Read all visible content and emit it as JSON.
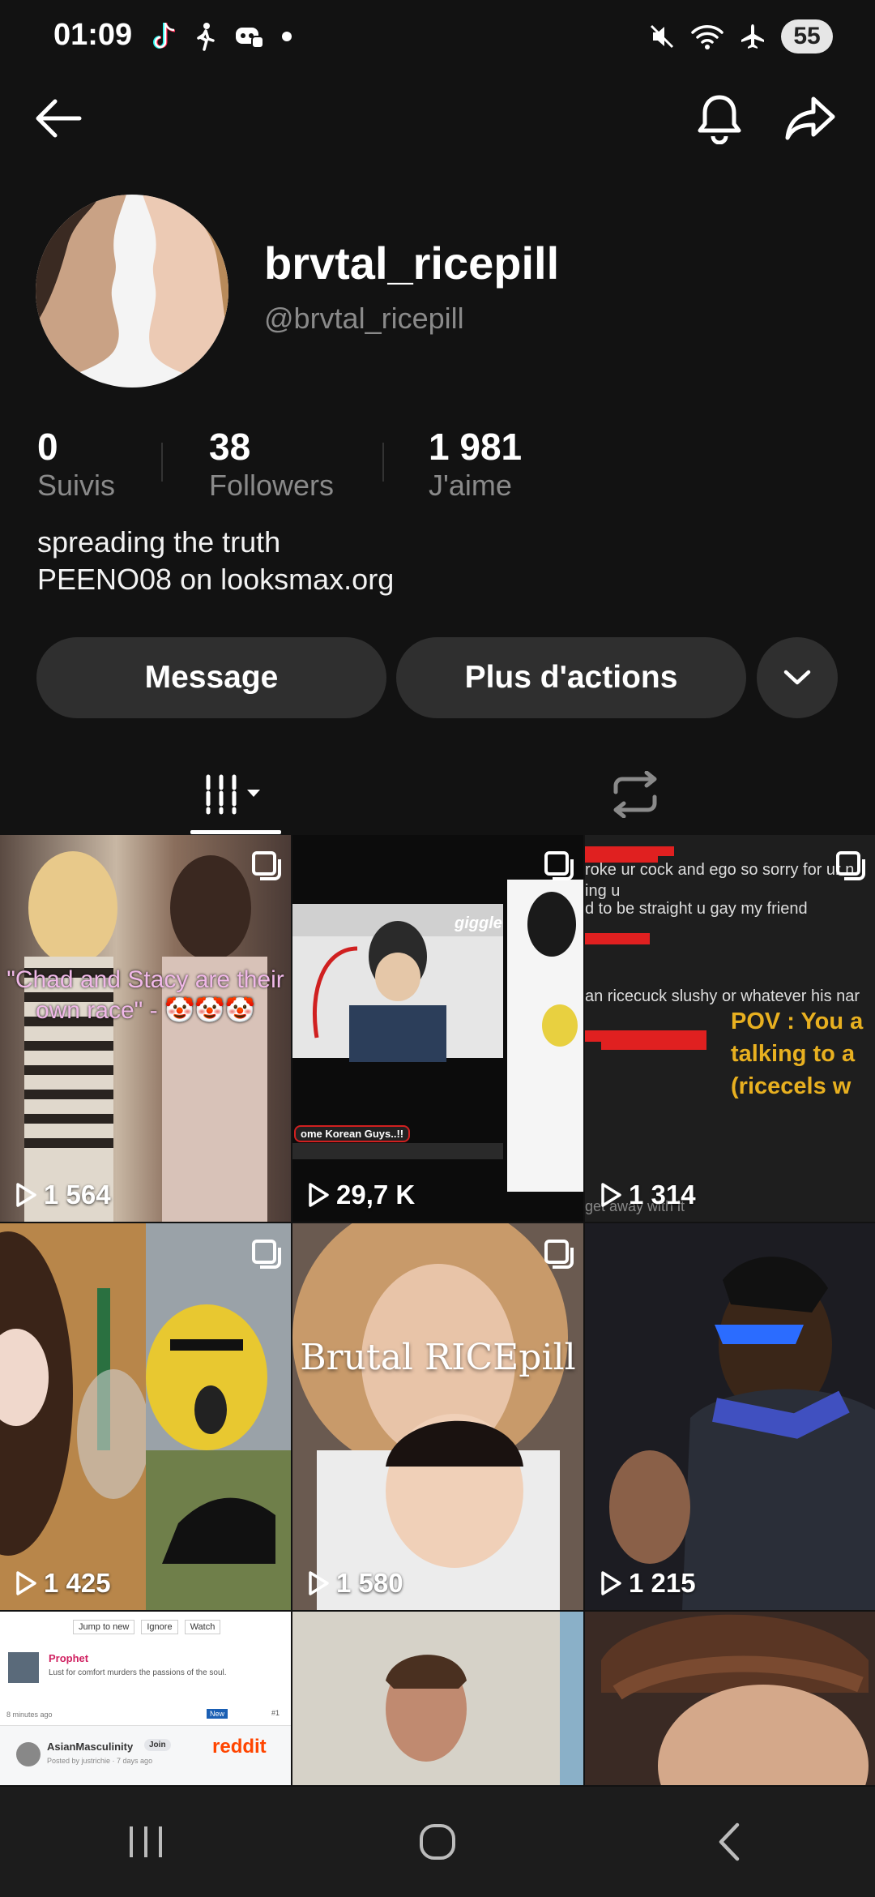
{
  "status_bar": {
    "time": "01:09",
    "battery": "55"
  },
  "profile": {
    "name": "brvtal_ricepill",
    "handle": "@brvtal_ricepill",
    "stats": [
      {
        "value": "0",
        "label": "Suivis"
      },
      {
        "value": "38",
        "label": "Followers"
      },
      {
        "value": "1 981",
        "label": "J'aime"
      }
    ],
    "bio_line1": "spreading the truth",
    "bio_line2": "PEENO08 on looksmax.org"
  },
  "actions": {
    "message": "Message",
    "more": "Plus d'actions"
  },
  "videos": [
    {
      "views": "1 564",
      "caption": "\"Chad and Stacy are their own race\" - 🤡🤡🤡",
      "multi": true,
      "bg": "#6b5a4e"
    },
    {
      "views": "29,7 K",
      "caption": "giggle",
      "sub_caption": "ome Korean Guys..!!",
      "multi": true,
      "bg": "#d8d8d8"
    },
    {
      "views": "1 314",
      "caption": "POV : You a talking to a (ricecels w",
      "lines": [
        "roke ur cock and ego so sorry for ur n",
        "ing u",
        "d to be straight u gay my friend",
        "an ricecuck slushy or whatever his nar",
        "get away with it"
      ],
      "multi": true,
      "bg": "#1e1e1e"
    },
    {
      "views": "1 425",
      "multi": true,
      "bg": "#7a6a50"
    },
    {
      "views": "1 580",
      "caption": "Brutal RICEpill",
      "multi": true,
      "bg": "#8a6a55"
    },
    {
      "views": "1 215",
      "bg": "#2a2a30"
    },
    {
      "caption": "Prophet",
      "sub_caption": "Lust for comfort murders the passions of the soul.",
      "menu": [
        "Jump to new",
        "Ignore",
        "Watch"
      ],
      "time": "8 minutes ago",
      "badge": "New",
      "number": "#1",
      "community": "AsianMasculinity",
      "poster": "Posted by justrichie · 7 days ago",
      "join": "Join",
      "brand": "reddit",
      "bg": "#ffffff"
    },
    {
      "bg": "#c9c2b8"
    },
    {
      "bg": "#6a4a3a"
    }
  ]
}
